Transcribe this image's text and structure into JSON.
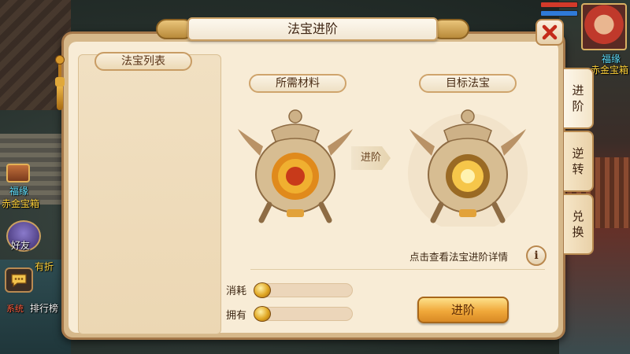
{
  "dialog": {
    "title": "法宝进阶",
    "left_panel_title": "法宝列表",
    "required_label": "所需材料",
    "target_label": "目标法宝",
    "arrow_label": "进阶",
    "detail_link": "点击查看法宝进阶详情",
    "info_icon_text": "i",
    "consume_label": "消耗",
    "own_label": "拥有",
    "advance_button": "进阶"
  },
  "tabs": [
    {
      "label": "进阶",
      "active": true
    },
    {
      "label": "逆转",
      "active": false
    },
    {
      "label": "兑换",
      "active": false
    }
  ],
  "background": {
    "right_name": "福缘",
    "right_chest": "赤金宝箱",
    "left_name": "福缘",
    "left_chest": "赤金宝箱",
    "friend_label": "好友",
    "partial_label": "有折",
    "rank_tag": "系统",
    "rank_label": "排行榜"
  },
  "colors": {
    "accent_gold": "#f0a83a",
    "name_cyan": "#5fe0ff",
    "chest_gold": "#ffd23a"
  },
  "icons": [
    "close-icon",
    "info-icon",
    "chat-icon",
    "gold-coin-icon",
    "artifact-pot-icon"
  ]
}
